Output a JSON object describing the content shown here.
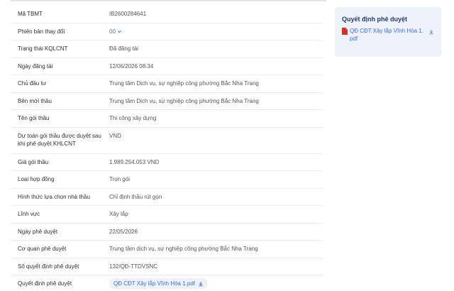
{
  "rows": [
    {
      "label": "Mã TBMT",
      "value": "IB2600284641"
    },
    {
      "label": "Phiên bản thay đổi",
      "value": "00"
    },
    {
      "label": "Trạng thái KQLCNT",
      "value": "Đã đăng tải"
    },
    {
      "label": "Ngày đăng tải",
      "value": "12/06/2026 08:34"
    },
    {
      "label": "Chủ đầu tư",
      "value": "Trung tâm Dịch vụ, sự nghiệp công phường Bắc Nha Trang"
    },
    {
      "label": "Bên mời thầu",
      "value": "Trung tâm Dịch vụ, sự nghiệp công phường Bắc Nha Trang"
    },
    {
      "label": "Tên gói thầu",
      "value": "Thi công xây dựng"
    },
    {
      "label": "Dự toán gói thầu được duyệt sau khi phê duyệt KHLCNT",
      "value": "VND"
    },
    {
      "label": "Giá gói thầu",
      "value": "1.989.254.053 VND"
    },
    {
      "label": "Loại hợp đồng",
      "value": "Trọn gói"
    },
    {
      "label": "Hình thức lựa chọn nhà thầu",
      "value": "Chỉ định thầu rút gọn"
    },
    {
      "label": "Lĩnh vực",
      "value": "Xây lắp"
    },
    {
      "label": "Ngày phê duyệt",
      "value": "22/05/2026"
    },
    {
      "label": "Cơ quan phê duyệt",
      "value": "Trung tâm dịch vụ, sự nghiệp công phường Bắc Nha Trang"
    },
    {
      "label": "Số quyết định phê duyệt",
      "value": "132/QĐ-TTDVSNC"
    },
    {
      "label": "Quyết định phê duyệt",
      "value": "QĐ CĐT Xây lắp Vĩnh Hòa 1.pdf"
    }
  ],
  "panel": {
    "title": "Quyết định phê duyệt",
    "file_name": "QĐ CĐT Xây lắp Vĩnh Hòa 1.pdf"
  },
  "colors": {
    "link": "#3b6fd6",
    "panel_bg": "#eef3fb",
    "pdf_red": "#d93025"
  }
}
